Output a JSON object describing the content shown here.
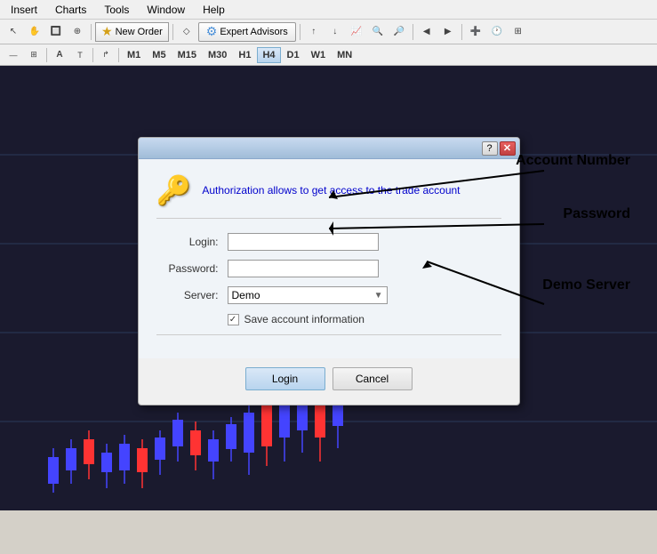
{
  "menubar": {
    "items": [
      "Insert",
      "Charts",
      "Tools",
      "Window",
      "Help"
    ]
  },
  "toolbar": {
    "new_order_label": "New Order",
    "expert_advisors_label": "Expert Advisors"
  },
  "timeframes": {
    "buttons": [
      "M1",
      "M5",
      "M15",
      "M30",
      "H1",
      "H4",
      "D1",
      "W1",
      "MN"
    ]
  },
  "dialog": {
    "info_text": "Authorization allows to get access to the trade account",
    "login_label": "Login:",
    "password_label": "Password:",
    "server_label": "Server:",
    "server_value": "Demo",
    "save_account_label": "Save account information",
    "login_btn": "Login",
    "cancel_btn": "Cancel"
  },
  "annotations": {
    "account_number": "Account Number",
    "password": "Password",
    "demo_server": "Demo Server"
  }
}
